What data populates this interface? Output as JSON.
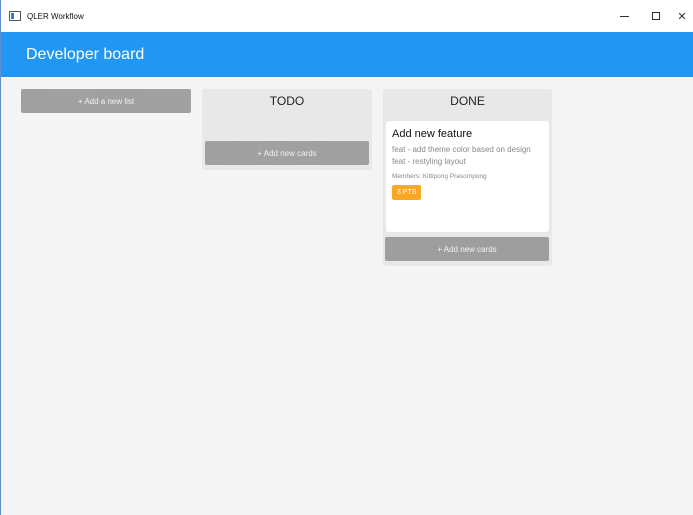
{
  "window": {
    "title": "QLER Workflow",
    "controls": {
      "minimize": "–",
      "close": "✕"
    }
  },
  "header": {
    "title": "Developer board"
  },
  "board": {
    "add_list_label": "+ Add a new list",
    "lists": [
      {
        "title": "TODO",
        "add_card_label": "+ Add new cards",
        "cards": []
      },
      {
        "title": "DONE",
        "add_card_label": "+ Add new cards",
        "cards": [
          {
            "title": "Add new feature",
            "description": [
              "feat - add theme color based on design",
              "feat - restyling layout"
            ],
            "members": "Members: Kittipong Prasompong",
            "points": "3 PTS"
          }
        ]
      }
    ]
  },
  "colors": {
    "header": "#2196f3",
    "badge": "#f9a825",
    "button": "#9e9e9e",
    "list_bg": "#e8e8ea"
  }
}
